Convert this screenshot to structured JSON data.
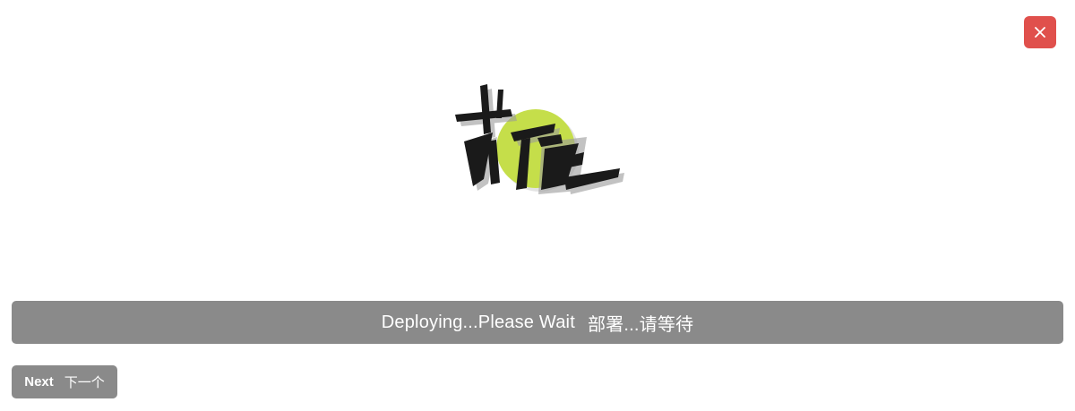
{
  "dialog": {
    "close_icon": "close-icon",
    "accent_color": "#e0504c"
  },
  "logo": {
    "name": "brand-logo",
    "circle_color": "#c5de4a",
    "ink_color": "#1a1a1a"
  },
  "status": {
    "text_en": "Deploying...Please Wait",
    "text_zh": "部署...请等待",
    "bar_color": "#8a8a8a"
  },
  "next_button": {
    "label_en": "Next",
    "label_zh": "下一个"
  }
}
